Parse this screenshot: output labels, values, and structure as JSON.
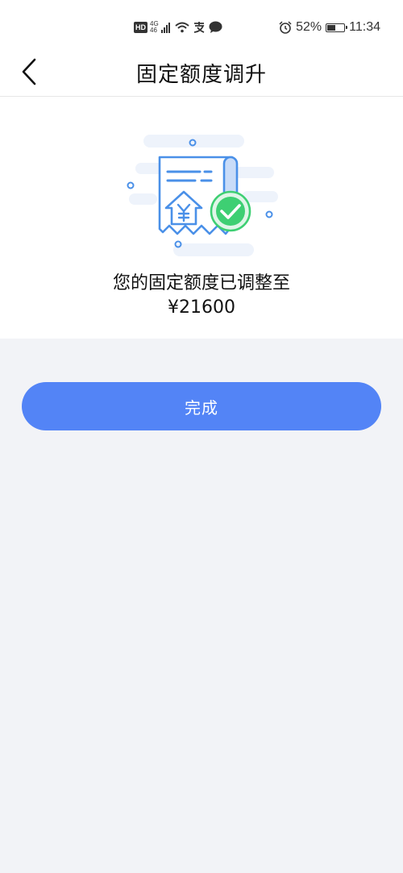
{
  "status_bar": {
    "hd": "HD",
    "network": "4G",
    "network_sub": "46",
    "battery_percent": "52%",
    "battery_level": 0.52,
    "time": "11:34",
    "icons": [
      "signal-icon",
      "wifi-icon",
      "alipay-icon",
      "chat-icon",
      "alarm-icon",
      "battery-icon"
    ]
  },
  "nav": {
    "back_icon": "chevron-left-icon",
    "title": "固定额度调升"
  },
  "result": {
    "illustration_icon": "receipt-yuan-check-icon",
    "message_line1": "您的固定额度已调整至",
    "amount": "¥21600"
  },
  "actions": {
    "done_label": "完成"
  },
  "colors": {
    "primary": "#5384f6",
    "success": "#3ecf73",
    "background": "#f2f3f7",
    "illustration_blue": "#4a90e8"
  }
}
